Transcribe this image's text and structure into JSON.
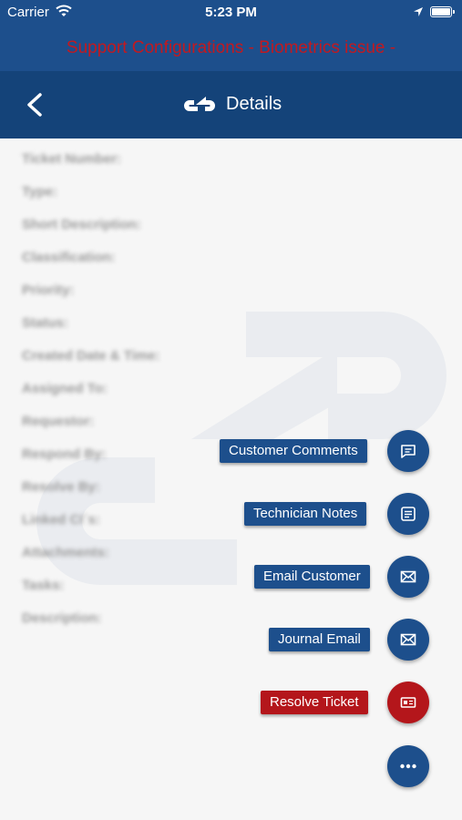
{
  "status_bar": {
    "carrier": "Carrier",
    "time": "5:23 PM"
  },
  "banner": {
    "message": "Support Configurations - Biometrics issue -"
  },
  "nav": {
    "title": "Details"
  },
  "detail_rows": [
    {
      "label": "Ticket Number:",
      "value": ""
    },
    {
      "label": "Type:",
      "value": ""
    },
    {
      "label": "Short Description:",
      "value": ""
    },
    {
      "label": "Classification:",
      "value": ""
    },
    {
      "label": "Priority:",
      "value": ""
    },
    {
      "label": "Status:",
      "value": ""
    },
    {
      "label": "Created Date & Time:",
      "value": ""
    },
    {
      "label": "Assigned To:",
      "value": ""
    },
    {
      "label": "Requestor:",
      "value": ""
    },
    {
      "label": "Respond By:",
      "value": ""
    },
    {
      "label": "Resolve By:",
      "value": ""
    },
    {
      "label": "Linked CI`s:",
      "value": ""
    },
    {
      "label": "Attachments:",
      "value": ""
    },
    {
      "label": "Tasks:",
      "value": ""
    },
    {
      "label": "Description:",
      "value": ""
    }
  ],
  "actions": {
    "customer_comments": "Customer Comments",
    "technician_notes": "Technician Notes",
    "email_customer": "Email Customer",
    "journal_email": "Journal Email",
    "resolve_ticket": "Resolve Ticket"
  },
  "colors": {
    "header_blue": "#1d4f8c",
    "nav_blue": "#144379",
    "banner_red": "#c3191f",
    "resolve_red": "#b4161b"
  }
}
